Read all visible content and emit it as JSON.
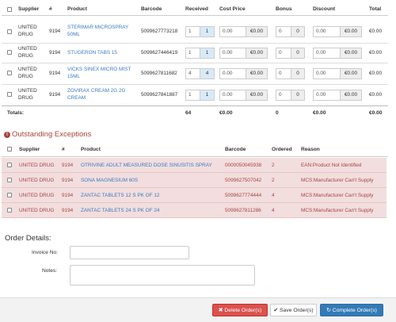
{
  "received_table": {
    "headers": [
      "Supplier",
      "#",
      "Product",
      "Barcode",
      "Received",
      "Cost Price",
      "Bonus",
      "Discount",
      "Total"
    ],
    "rows": [
      {
        "supplier": "UNITED DRUG",
        "num": "9194",
        "product": "STERIMAR MICROSPRAY 50ML",
        "barcode": "5099627773218",
        "rec_a": "1",
        "rec_b": "1",
        "cost": "0.00",
        "cost_add": "€0.00",
        "bonus": "0",
        "bonus_add": "0",
        "disc": "0.00",
        "disc_add": "€0.00",
        "total": "€0.00"
      },
      {
        "supplier": "UNITED DRUG",
        "num": "9194",
        "product": "STUGERON TABS 15",
        "barcode": "5099627446419",
        "rec_a": "1",
        "rec_b": "1",
        "cost": "0.00",
        "cost_add": "€0.00",
        "bonus": "0",
        "bonus_add": "0",
        "disc": "0.00",
        "disc_add": "€0.00",
        "total": "€0.00"
      },
      {
        "supplier": "UNITED DRUG",
        "num": "9194",
        "product": "VICKS SINEX MICRO MIST 15ML",
        "barcode": "5099627811682",
        "rec_a": "4",
        "rec_b": "4",
        "cost": "0.00",
        "cost_add": "€0.00",
        "bonus": "0",
        "bonus_add": "0",
        "disc": "0.00",
        "disc_add": "€0.00",
        "total": "€0.00"
      },
      {
        "supplier": "UNITED DRUG",
        "num": "9194",
        "product": "ZOVIRAX CREAM 2G 2G CREAM",
        "barcode": "5099627841887",
        "rec_a": "1",
        "rec_b": "1",
        "cost": "0.00",
        "cost_add": "€0.00",
        "bonus": "0",
        "bonus_add": "0",
        "disc": "0.00",
        "disc_add": "€0.00",
        "total": "€0.00"
      }
    ],
    "totals": {
      "label": "Totals:",
      "received": "64",
      "cost": "€0.00",
      "bonus": "0",
      "discount": "€0.00",
      "total": "€0.00"
    }
  },
  "exceptions": {
    "title": "Outstanding Exceptions",
    "headers": [
      "Supplier",
      "#",
      "Product",
      "Barcode",
      "Ordered",
      "Reason"
    ],
    "rows": [
      {
        "supplier": "UNITED DRUG",
        "num": "9194",
        "product": "OTRIVINE ADULT MEASURED DOSE SINUSITIS SPRAY",
        "barcode": "0000050045938",
        "ordered": "2",
        "reason": "EAN:Product Not Identified"
      },
      {
        "supplier": "UNITED DRUG",
        "num": "9194",
        "product": "SONA MAGNESIUM 60S",
        "barcode": "5099627507042",
        "ordered": "2",
        "reason": "MCS:Manufacturer Can't Supply"
      },
      {
        "supplier": "UNITED DRUG",
        "num": "9194",
        "product": "ZANTAC TABLETS 12 S PK OF 12",
        "barcode": "5099627774444",
        "ordered": "4",
        "reason": "MCS:Manufacturer Can't Supply"
      },
      {
        "supplier": "UNITED DRUG",
        "num": "9194",
        "product": "ZANTAC TABLETS 24 S PK OF 24",
        "barcode": "5099627811286",
        "ordered": "4",
        "reason": "MCS:Manufacturer Can't Supply"
      }
    ]
  },
  "order_details": {
    "title": "Order Details:",
    "invoice_label": "Invoice No:",
    "invoice_value": "",
    "notes_label": "Notes:",
    "notes_value": ""
  },
  "buttons": {
    "delete": "Delete Order(s)",
    "save": "Save Order(s)",
    "complete": "Complete Order(s)"
  },
  "icons": {
    "warning": "exclamation-circle-icon",
    "delete": "times-icon",
    "save": "check-icon",
    "complete": "refresh-icon"
  },
  "colors": {
    "link": "#3a7bc0",
    "exception_bg": "#f2dede",
    "exception_text": "#a94442",
    "delete_btn": "#d9534f",
    "complete_btn": "#337ab7"
  }
}
